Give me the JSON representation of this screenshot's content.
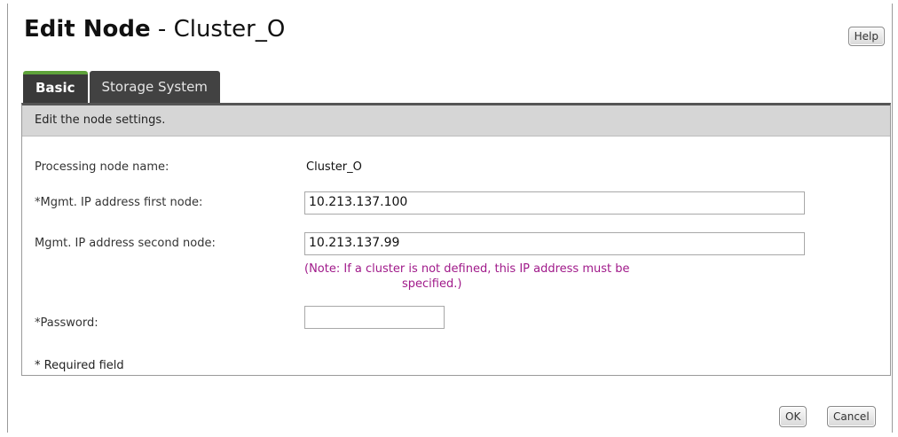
{
  "dialog": {
    "title_action": "Edit Node",
    "title_separator": " - ",
    "title_name": "Cluster_O",
    "help_label": "Help"
  },
  "tabs": [
    {
      "label": "Basic",
      "active": true
    },
    {
      "label": "Storage System",
      "active": false
    }
  ],
  "panel": {
    "header": "Edit the node settings."
  },
  "form": {
    "node_name_label": "Processing node name:",
    "node_name_value": "Cluster_O",
    "ip_first_label": "*Mgmt. IP address first node:",
    "ip_first_value": "10.213.137.100",
    "ip_second_label": "Mgmt. IP address second node:",
    "ip_second_value": "10.213.137.99",
    "note_line1": "(Note: If a cluster is not defined, this IP address must be",
    "note_line2": "specified.)",
    "password_label": "*Password:",
    "password_value": "",
    "required_note": "* Required field"
  },
  "buttons": {
    "ok": "OK",
    "cancel": "Cancel"
  },
  "colors": {
    "tab_active_accent": "#5ea23a",
    "note_text": "#a01a8a",
    "panel_header_bg": "#d6d6d6"
  }
}
